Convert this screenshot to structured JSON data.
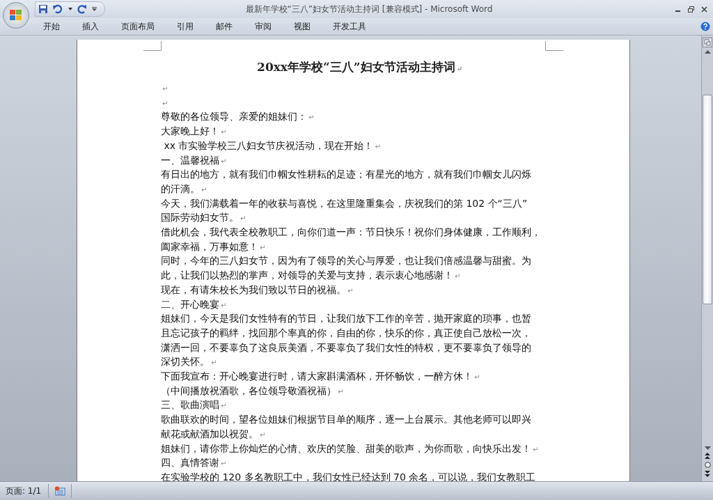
{
  "window": {
    "title": "最新年学校“三八”妇女节活动主持词 [兼容模式] - Microsoft Word"
  },
  "ribbon_tabs": [
    {
      "label": "开始",
      "selected": false
    },
    {
      "label": "插入",
      "selected": false
    },
    {
      "label": "页面布局",
      "selected": false
    },
    {
      "label": "引用",
      "selected": false
    },
    {
      "label": "邮件",
      "selected": false
    },
    {
      "label": "审阅",
      "selected": false
    },
    {
      "label": "视图",
      "selected": false
    },
    {
      "label": "开发工具",
      "selected": false
    }
  ],
  "document": {
    "title": "20xx年学校“三八”妇女节活动主持词",
    "title_mark": "↵",
    "paragraphs": [
      {
        "mark": "↵"
      },
      {
        "mark": "↵"
      },
      {
        "lines": [
          "尊敬的各位领导、亲爱的姐妹们："
        ],
        "mark": "↵"
      },
      {
        "lines": [
          "大家晚上好！"
        ],
        "mark": "↵"
      },
      {
        "lines": [
          " xx 市实验学校三八妇女节庆祝活动，现在开始！"
        ],
        "mark": "↵"
      },
      {
        "lines": [
          "一、温馨祝福"
        ],
        "mark": "↵"
      },
      {
        "lines": [
          "有日出的地方，就有我们巾帼女性耕耘的足迹；有星光的地方，就有我们巾帼女儿闪烁",
          "的汗滴。"
        ],
        "mark": "↵"
      },
      {
        "lines": [
          "今天，我们满载着一年的收获与喜悦，在这里隆重集会，庆祝我们的第 102 个“三八”",
          "国际劳动妇女节。"
        ],
        "mark": "↵"
      },
      {
        "lines": [
          "借此机会，我代表全校教职工，向你们道一声：节日快乐！祝你们身体健康，工作顺利，",
          "阖家幸福，万事如意！"
        ],
        "mark": "↵"
      },
      {
        "lines": [
          "同时，今年的三八妇女节，因为有了领导的关心与厚爱，也让我们倍感温馨与甜蜜。为",
          "此，让我们以热烈的掌声，对领导的关爱与支持，表示衷心地感谢！"
        ],
        "mark": "↵"
      },
      {
        "lines": [
          "现在，有请朱校长为我们致以节日的祝福。"
        ],
        "mark": "↵"
      },
      {
        "lines": [
          "二、开心晚宴"
        ],
        "mark": "↵"
      },
      {
        "lines": [
          "姐妹们，今天是我们女性特有的节日，让我们放下工作的辛苦，抛开家庭的琐事，也暂",
          "且忘记孩子的羁绊，找回那个率真的你，自由的你，快乐的你，真正使自己放松一次，",
          "潇洒一回，不要辜负了这良辰美酒，不要辜负了我们女性的特权，更不要辜负了领导的",
          "深切关怀。"
        ],
        "mark": "↵"
      },
      {
        "lines": [
          "下面我宣布：开心晚宴进行时，请大家斟满酒杯，开怀畅饮，一醉方休！"
        ],
        "mark": "↵"
      },
      {
        "lines": [
          "（中间播放祝酒歌，各位领导敬酒祝福）"
        ],
        "mark": "↵"
      },
      {
        "lines": [
          "三、歌曲演唱"
        ],
        "mark": "↵"
      },
      {
        "lines": [
          "歌曲联欢的时间，望各位姐妹们根据节目单的顺序，逐一上台展示。其他老师可以即兴",
          "献花或献酒加以祝贺。"
        ],
        "mark": "↵"
      },
      {
        "lines": [
          "姐妹们，请你带上你灿烂的心情、欢庆的笑脸、甜美的歌声，为你而歌，向快乐出发！"
        ],
        "mark": "↵"
      },
      {
        "lines": [
          "四、真情答谢"
        ],
        "mark": "↵"
      },
      {
        "lines": [
          "在实验学校的 120 多名教职工中，我们女性已经达到 70 余名，可以说，我们女教职工"
        ]
      }
    ]
  },
  "status_bar": {
    "page": "页面: 1/1"
  }
}
